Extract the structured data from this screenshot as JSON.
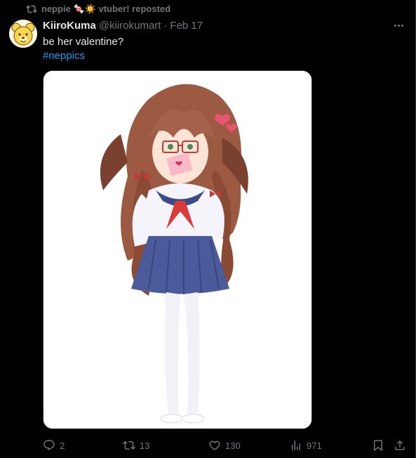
{
  "repost": {
    "label": "neppie 🍬☀️ vtuber! reposted"
  },
  "author": {
    "display_name": "KiiroKuma",
    "handle": "@kiirokumart",
    "separator": "·",
    "date": "Feb 17"
  },
  "tweet": {
    "text": "be her valentine?",
    "hashtag": "#neppics"
  },
  "actions": {
    "replies": "2",
    "reposts": "13",
    "likes": "130",
    "views": "971"
  },
  "colors": {
    "background": "#000000",
    "text": "#e7e9ea",
    "muted": "#71767b",
    "link": "#1d9bf0"
  },
  "icons": {
    "repost_indicator": "repost-icon",
    "more": "more-icon",
    "reply": "reply-icon",
    "repost": "repost-icon",
    "like": "heart-icon",
    "views": "views-icon",
    "bookmark": "bookmark-icon",
    "share": "share-icon"
  }
}
